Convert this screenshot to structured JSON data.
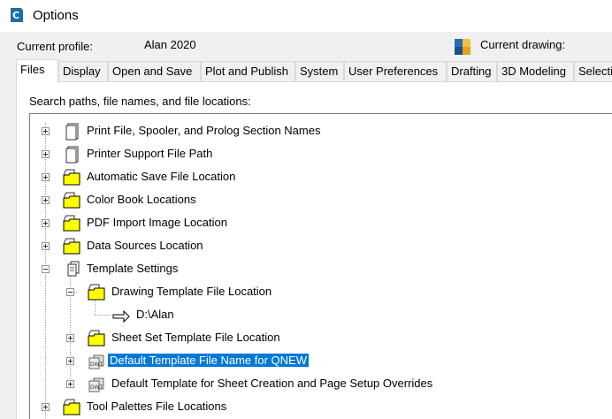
{
  "window": {
    "title": "Options"
  },
  "profile": {
    "label": "Current profile:",
    "value": "Alan 2020",
    "drawing_label": "Current drawing:"
  },
  "tabs": [
    "Files",
    "Display",
    "Open and Save",
    "Plot and Publish",
    "System",
    "User Preferences",
    "Drafting",
    "3D Modeling",
    "Selection"
  ],
  "panel": {
    "search_label": "Search paths, file names, and file locations:"
  },
  "tree": [
    {
      "label": "Print File, Spooler, and Prolog Section Names",
      "icon": "file-icon"
    },
    {
      "label": "Printer Support File Path",
      "icon": "file-icon"
    },
    {
      "label": "Automatic Save File Location",
      "icon": "folder-icon"
    },
    {
      "label": "Color Book Locations",
      "icon": "folder-icon"
    },
    {
      "label": "PDF Import Image Location",
      "icon": "folder-icon"
    },
    {
      "label": "Data Sources Location",
      "icon": "folder-icon"
    },
    {
      "label": "Template Settings",
      "icon": "documents-icon"
    },
    {
      "label": "Drawing Template File Location",
      "icon": "folder-icon"
    },
    {
      "label": "D:\\Alan",
      "icon": "arrow-icon"
    },
    {
      "label": "Sheet Set Template File Location",
      "icon": "folder-icon"
    },
    {
      "label": "Default Template File Name for QNEW",
      "icon": "template-file-icon"
    },
    {
      "label": "Default Template for Sheet Creation and Page Setup Overrides",
      "icon": "template-file-icon"
    },
    {
      "label": "Tool Palettes File Locations",
      "icon": "folder-icon"
    }
  ]
}
